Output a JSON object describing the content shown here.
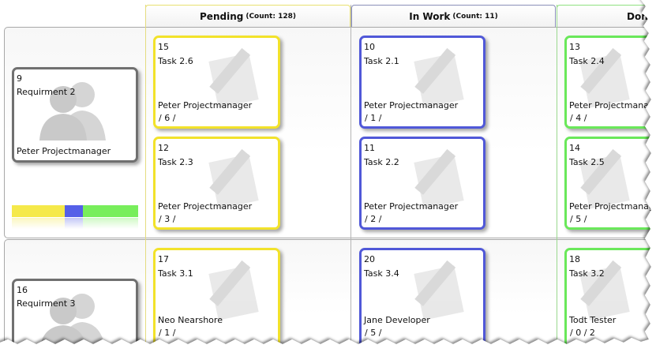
{
  "colors": {
    "pending": "#f2e22a",
    "in_work": "#5058d8",
    "done": "#6ae85a",
    "requirement": "#707070"
  },
  "columns": [
    {
      "name": "Pending",
      "count": "(Count: 128)"
    },
    {
      "name": "In Work",
      "count": "(Count: 11)"
    },
    {
      "name": "Don",
      "count": ""
    }
  ],
  "lanes": [
    {
      "requirement": {
        "id": "9",
        "title": "Requirment 2",
        "owner": "Peter Projectmanager",
        "icon": "people-icon"
      },
      "progress": {
        "pending": 0.42,
        "in_work": 0.14,
        "done": 0.44
      },
      "pending": [
        {
          "id": "15",
          "title": "Task 2.6",
          "owner": "Peter Projectmanager",
          "estimate": "/ 6 /"
        },
        {
          "id": "12",
          "title": "Task 2.3",
          "owner": "Peter Projectmanager",
          "estimate": "/ 3 /"
        }
      ],
      "in_work": [
        {
          "id": "10",
          "title": "Task 2.1",
          "owner": "Peter Projectmanager",
          "estimate": "/ 1 /"
        },
        {
          "id": "11",
          "title": "Task 2.2",
          "owner": "Peter Projectmanager",
          "estimate": "/ 2 /"
        }
      ],
      "done": [
        {
          "id": "13",
          "title": "Task 2.4",
          "owner": "Peter Projectmanager",
          "estimate": "/ 4 /"
        },
        {
          "id": "14",
          "title": "Task 2.5",
          "owner": "Peter Projectmanager",
          "estimate": "/ 5 /"
        }
      ]
    },
    {
      "requirement": {
        "id": "16",
        "title": "Requirment 3",
        "owner": "",
        "icon": "people-icon"
      },
      "pending": [
        {
          "id": "17",
          "title": "Task 3.1",
          "owner": "Neo Nearshore",
          "estimate": "/ 1 /"
        }
      ],
      "in_work": [
        {
          "id": "20",
          "title": "Task 3.4",
          "owner": "Jane Developer",
          "estimate": "/ 5 /"
        }
      ],
      "done": [
        {
          "id": "18",
          "title": "Task 3.2",
          "owner": "Todt Tester",
          "estimate": "/ 0 / 2"
        }
      ]
    }
  ]
}
